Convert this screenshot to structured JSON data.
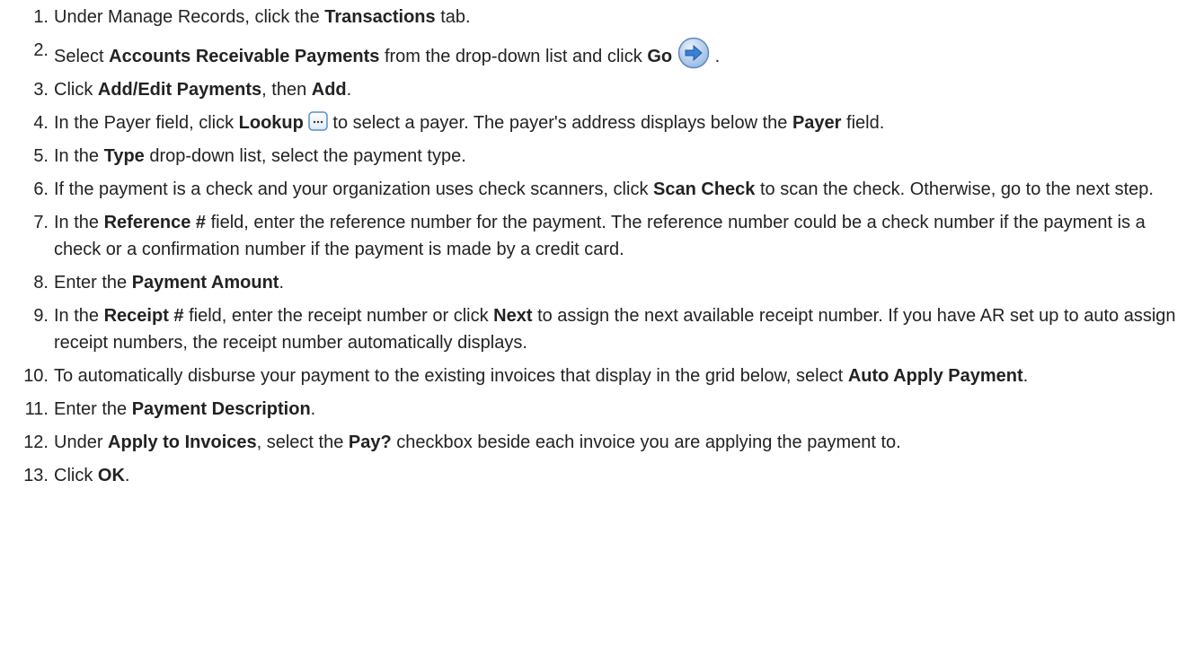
{
  "steps": [
    {
      "num": "1.",
      "parts": [
        {
          "t": "Under Manage Records, click the "
        },
        {
          "t": "Transactions",
          "b": true
        },
        {
          "t": " tab."
        }
      ]
    },
    {
      "num": "2.",
      "parts": [
        {
          "t": "Select "
        },
        {
          "t": "Accounts Receivable Payments",
          "b": true
        },
        {
          "t": " from the drop-down list and click "
        },
        {
          "t": "Go",
          "b": true
        },
        {
          "icon": "go-arrow-icon"
        },
        {
          "t": " ."
        }
      ]
    },
    {
      "num": "3.",
      "parts": [
        {
          "t": "Click "
        },
        {
          "t": "Add/Edit Payments",
          "b": true
        },
        {
          "t": ", then "
        },
        {
          "t": "Add",
          "b": true
        },
        {
          "t": "."
        }
      ]
    },
    {
      "num": "4.",
      "parts": [
        {
          "t": "In the Payer field, click "
        },
        {
          "t": "Lookup",
          "b": true
        },
        {
          "icon": "lookup-icon"
        },
        {
          "t": " to select a payer. The payer's address displays below the "
        },
        {
          "t": "Payer",
          "b": true
        },
        {
          "t": " field."
        }
      ]
    },
    {
      "num": "5.",
      "parts": [
        {
          "t": "In the "
        },
        {
          "t": "Type",
          "b": true
        },
        {
          "t": " drop-down list, select the payment type."
        }
      ]
    },
    {
      "num": "6.",
      "parts": [
        {
          "t": "If the payment is a check and your organization uses check scanners, click "
        },
        {
          "t": "Scan Check",
          "b": true
        },
        {
          "t": " to scan the check. Otherwise, go to the next step."
        }
      ]
    },
    {
      "num": "7.",
      "parts": [
        {
          "t": "In the "
        },
        {
          "t": "Reference #",
          "b": true
        },
        {
          "t": " field, enter the reference number for the payment. The reference number could be a check number if the payment is a check or a confirmation number if the payment is made by a credit card."
        }
      ]
    },
    {
      "num": "8.",
      "parts": [
        {
          "t": "Enter the "
        },
        {
          "t": "Payment Amount",
          "b": true
        },
        {
          "t": "."
        }
      ]
    },
    {
      "num": "9.",
      "parts": [
        {
          "t": "In the "
        },
        {
          "t": "Receipt #",
          "b": true
        },
        {
          "t": " field, enter the receipt number or click "
        },
        {
          "t": "Next",
          "b": true
        },
        {
          "t": " to assign the next available receipt number. If you have AR set up to auto assign receipt numbers, the receipt number automatically displays."
        }
      ]
    },
    {
      "num": "10.",
      "parts": [
        {
          "t": "To automatically disburse your payment to the existing invoices that display in the grid below, select "
        },
        {
          "t": "Auto Apply Payment",
          "b": true
        },
        {
          "t": "."
        }
      ]
    },
    {
      "num": "11.",
      "parts": [
        {
          "t": "Enter the "
        },
        {
          "t": "Payment Description",
          "b": true
        },
        {
          "t": "."
        }
      ]
    },
    {
      "num": "12.",
      "parts": [
        {
          "t": "Under "
        },
        {
          "t": "Apply to Invoices",
          "b": true
        },
        {
          "t": ", select the "
        },
        {
          "t": "Pay?",
          "b": true
        },
        {
          "t": " checkbox beside each invoice you are applying the payment to."
        }
      ]
    },
    {
      "num": "13.",
      "parts": [
        {
          "t": "Click "
        },
        {
          "t": "OK",
          "b": true
        },
        {
          "t": "."
        }
      ]
    }
  ],
  "colors": {
    "text": "#222222",
    "go_icon_fill": "#3a7fd5",
    "lookup_icon_border": "#5a8fc8"
  }
}
